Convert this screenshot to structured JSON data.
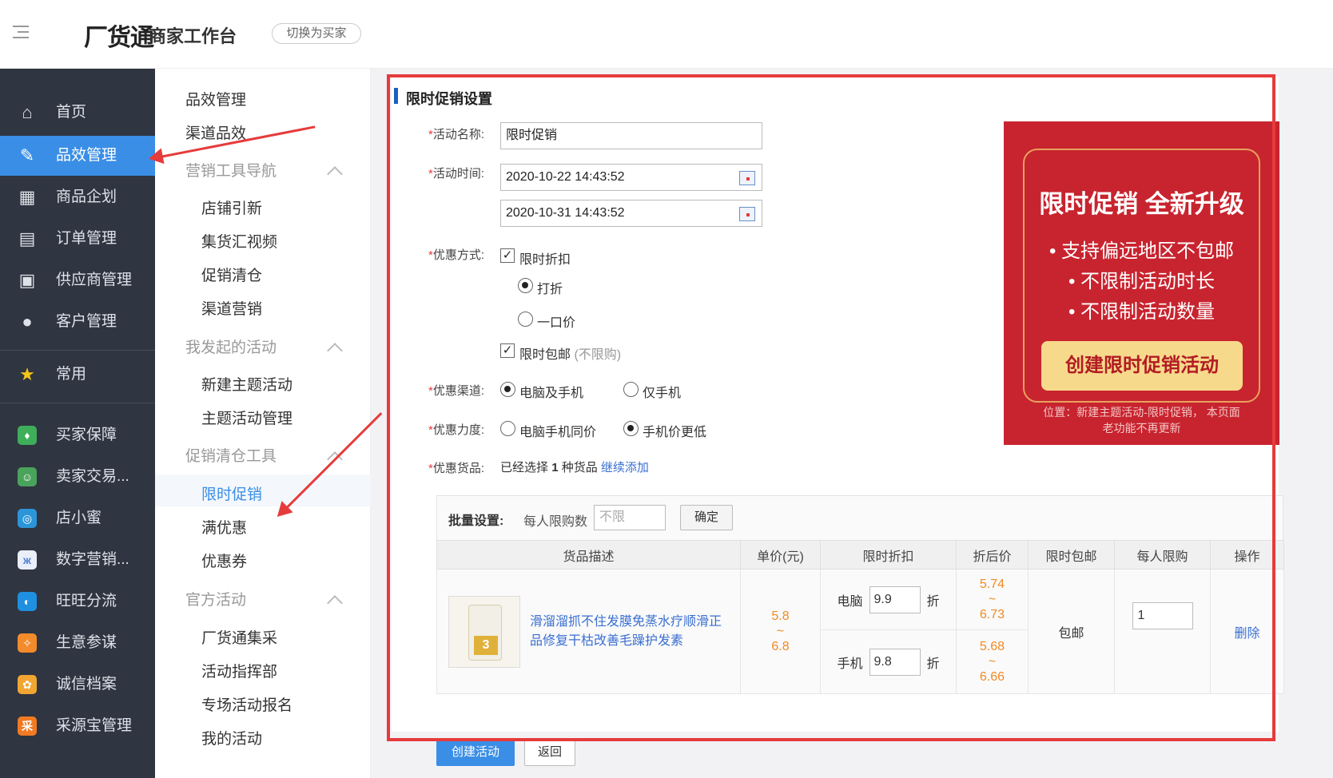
{
  "header": {
    "logo": "厂货通",
    "logo_sub": "商家工作台",
    "switch_label": "切换为买家"
  },
  "sidebar": {
    "items": [
      {
        "label": "首页",
        "icon": "home-icon"
      },
      {
        "label": "品效管理",
        "icon": "edit-chart-icon",
        "active": true
      },
      {
        "label": "商品企划",
        "icon": "calendar-icon"
      },
      {
        "label": "订单管理",
        "icon": "clipboard-icon"
      },
      {
        "label": "供应商管理",
        "icon": "contact-card-icon"
      },
      {
        "label": "客户管理",
        "icon": "user-icon"
      },
      {
        "label": "常用",
        "icon": "star-icon"
      },
      {
        "label": "买家保障",
        "icon": "shield-app-icon"
      },
      {
        "label": "卖家交易...",
        "icon": "seller-app-icon"
      },
      {
        "label": "店小蜜",
        "icon": "robot-app-icon"
      },
      {
        "label": "数字营销...",
        "icon": "butterfly-app-icon"
      },
      {
        "label": "旺旺分流",
        "icon": "chat-app-icon"
      },
      {
        "label": "生意参谋",
        "icon": "compass-app-icon"
      },
      {
        "label": "诚信档案",
        "icon": "archive-app-icon"
      },
      {
        "label": "采源宝管理",
        "icon": "cai-app-icon",
        "glyph": "采"
      }
    ]
  },
  "subnav": {
    "items": [
      {
        "label": "品效管理",
        "type": "item"
      },
      {
        "label": "渠道品效",
        "type": "item"
      },
      {
        "label": "营销工具导航",
        "type": "group"
      },
      {
        "label": "店铺引新",
        "type": "child"
      },
      {
        "label": "集货汇视频",
        "type": "child"
      },
      {
        "label": "促销清仓",
        "type": "child"
      },
      {
        "label": "渠道营销",
        "type": "child"
      },
      {
        "label": "我发起的活动",
        "type": "group"
      },
      {
        "label": "新建主题活动",
        "type": "child"
      },
      {
        "label": "主题活动管理",
        "type": "child"
      },
      {
        "label": "促销清仓工具",
        "type": "group"
      },
      {
        "label": "限时促销",
        "type": "child",
        "active": true
      },
      {
        "label": "满优惠",
        "type": "child"
      },
      {
        "label": "优惠券",
        "type": "child"
      },
      {
        "label": "官方活动",
        "type": "group"
      },
      {
        "label": "厂货通集采",
        "type": "child"
      },
      {
        "label": "活动指挥部",
        "type": "child"
      },
      {
        "label": "专场活动报名",
        "type": "child"
      },
      {
        "label": "我的活动",
        "type": "child"
      }
    ]
  },
  "form": {
    "title": "限时促销设置",
    "required_mark": "*",
    "name_label": "活动名称:",
    "name_value": "限时促销",
    "time_label": "活动时间:",
    "start_time": "2020-10-22 14:43:52",
    "end_time": "2020-10-31 14:43:52",
    "discount_label": "优惠方式:",
    "discount_check": "限时折扣",
    "discount_opt1": "打折",
    "discount_opt2": "一口价",
    "shipping_check": "限时包邮",
    "shipping_note": "(不限购)",
    "channel_label": "优惠渠道:",
    "channel_opt1": "电脑及手机",
    "channel_opt2": "仅手机",
    "level_label": "优惠力度:",
    "level_opt1": "电脑手机同价",
    "level_opt2": "手机价更低",
    "goods_label": "优惠货品:",
    "goods_text_pre": "已经选择",
    "goods_count": "1",
    "goods_text_post": "种货品",
    "goods_add": "继续添加"
  },
  "banner": {
    "headline": "限时促销 全新升级",
    "lines": [
      "• 支持偏远地区不包邮",
      "• 不限制活动时长",
      "• 不限制活动数量"
    ],
    "button": "创建限时促销活动",
    "note1": "位置：新建主题活动-限时促销， 本页面",
    "note2": "老功能不再更新"
  },
  "batch": {
    "label": "批量设置:",
    "limit_label": "每人限购数",
    "limit_placeholder": "不限",
    "confirm": "确定"
  },
  "table": {
    "headers": [
      "货品描述",
      "单价(元)",
      "限时折扣",
      "折后价",
      "限时包邮",
      "每人限购",
      "操作"
    ],
    "row": {
      "desc": "滑溜溜抓不住发膜免蒸水疗顺滑正品修复干枯改善毛躁护发素",
      "price_low": "5.8",
      "price_sep": "~",
      "price_high": "6.8",
      "pc_label": "电脑",
      "pc_value": "9.9",
      "mobile_label": "手机",
      "mobile_value": "9.8",
      "unit": "折",
      "pc_after_low": "5.74",
      "pc_after_high": "6.73",
      "mobile_after_low": "5.68",
      "mobile_after_high": "6.66",
      "shipping": "包邮",
      "limit_value": "1",
      "action": "删除"
    }
  },
  "footer": {
    "create": "创建活动",
    "back": "返回"
  },
  "colors": {
    "accent": "#3a8ee6",
    "sidebar_bg": "#2f3541",
    "highlight_frame": "#e63b3b",
    "price": "#f08a24",
    "banner_bg": "#c8242f"
  }
}
